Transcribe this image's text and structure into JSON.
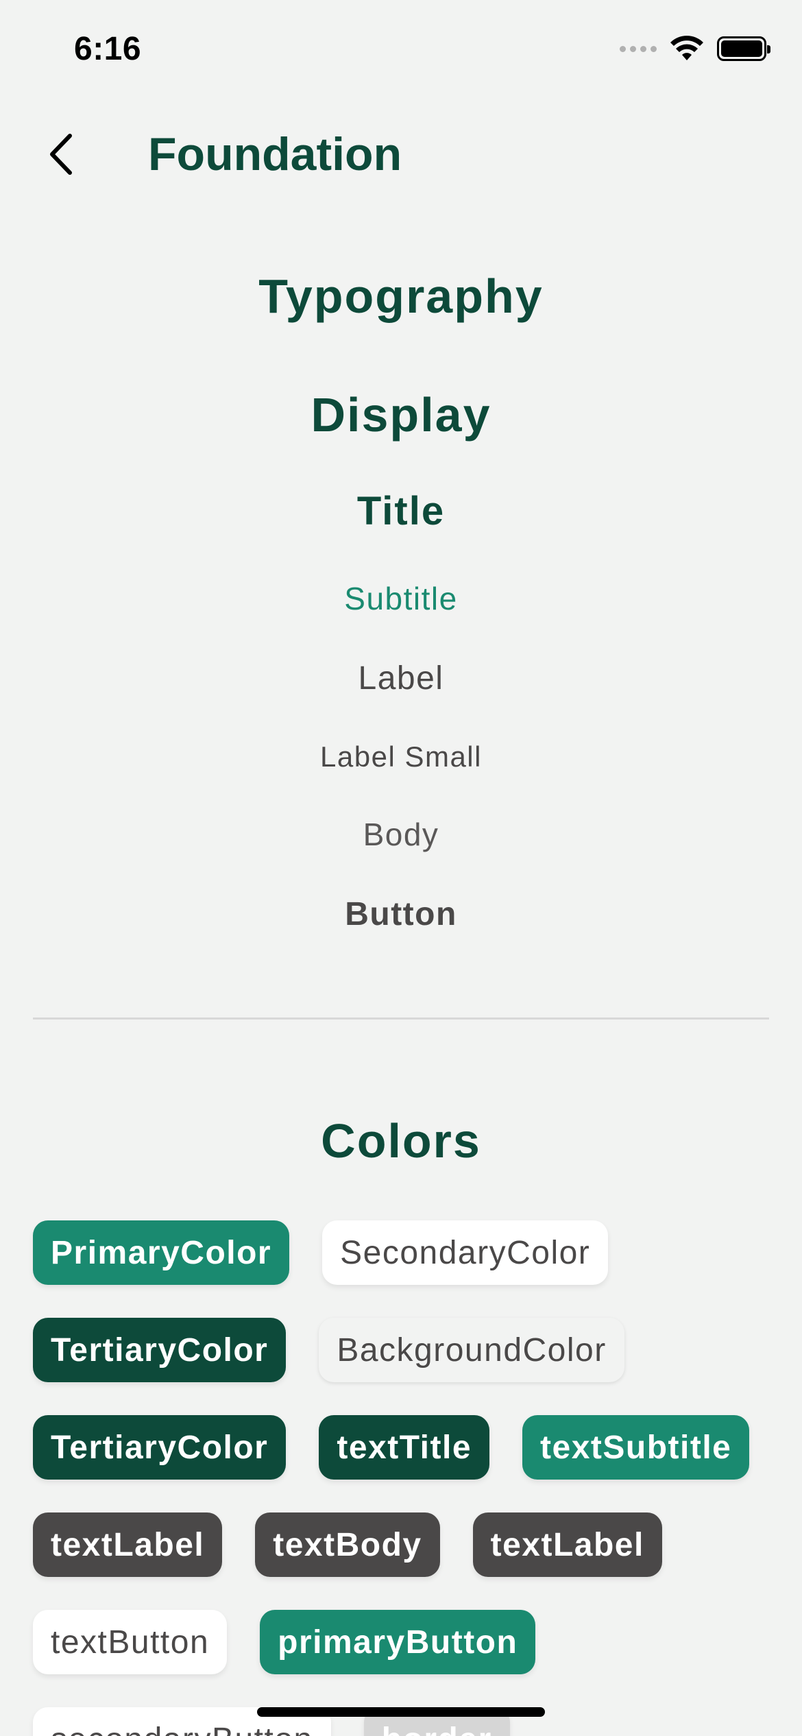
{
  "status_bar": {
    "time": "6:16"
  },
  "nav": {
    "title": "Foundation"
  },
  "typography": {
    "heading": "Typography",
    "display": "Display",
    "title": "Title",
    "subtitle": "Subtitle",
    "label": "Label",
    "label_small": "Label Small",
    "body": "Body",
    "button": "Button"
  },
  "colors": {
    "heading": "Colors",
    "rows": [
      [
        {
          "label": "PrimaryColor"
        },
        {
          "label": "SecondaryColor"
        }
      ],
      [
        {
          "label": "TertiaryColor"
        },
        {
          "label": "BackgroundColor"
        }
      ],
      [
        {
          "label": "TertiaryColor"
        },
        {
          "label": "textTitle"
        },
        {
          "label": "textSubtitle"
        }
      ],
      [
        {
          "label": "textLabel"
        },
        {
          "label": "textBody"
        },
        {
          "label": "textLabel"
        }
      ],
      [
        {
          "label": "textButton"
        },
        {
          "label": "primaryButton"
        }
      ],
      [
        {
          "label": "secondaryButton"
        },
        {
          "label": "border"
        }
      ]
    ],
    "palette": {
      "primary": "#1a8a70",
      "secondary": "#ffffff",
      "tertiary": "#0d4a3a",
      "background": "#f2f3f2",
      "text_label": "#4a4848",
      "border": "#d6d6d6"
    }
  },
  "icons": {
    "back": "chevron-left-icon",
    "wifi": "wifi-icon",
    "battery": "battery-icon",
    "signal": "cellular-signal-icon"
  }
}
